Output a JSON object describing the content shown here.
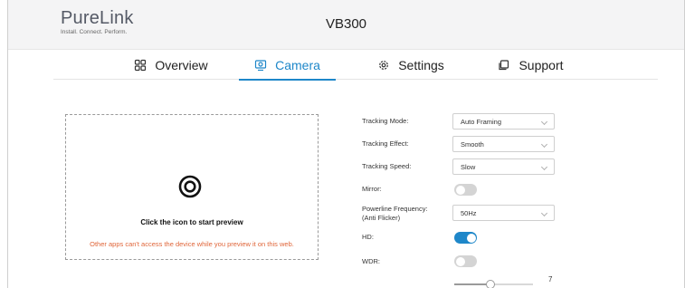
{
  "brand": {
    "name": "PureLink",
    "tagline": "Install. Connect. Perform."
  },
  "product": {
    "title": "VB300"
  },
  "tabs": [
    {
      "label": "Overview",
      "icon": "grid-icon"
    },
    {
      "label": "Camera",
      "icon": "camera-icon",
      "active": true
    },
    {
      "label": "Settings",
      "icon": "gear-icon"
    },
    {
      "label": "Support",
      "icon": "support-icon"
    }
  ],
  "preview": {
    "title": "Click the icon to start preview",
    "warning": "Other apps can't access the device while you preview it on this web."
  },
  "settings": {
    "tracking_mode": {
      "label": "Tracking Mode:",
      "value": "Auto Framing"
    },
    "tracking_effect": {
      "label": "Tracking Effect:",
      "value": "Smooth"
    },
    "tracking_speed": {
      "label": "Tracking Speed:",
      "value": "Slow"
    },
    "mirror": {
      "label": "Mirror:",
      "on": false
    },
    "powerline": {
      "label": "Powerline Frequency:",
      "label2": "(Anti Flicker)",
      "value": "50Hz"
    },
    "hd": {
      "label": "HD:",
      "on": true
    },
    "wdr": {
      "label": "WDR:",
      "on": false
    },
    "wdr_level": {
      "value": "7",
      "fraction": 0.45
    }
  },
  "colors": {
    "accent": "#1e87c9",
    "warning": "#e0663a"
  }
}
